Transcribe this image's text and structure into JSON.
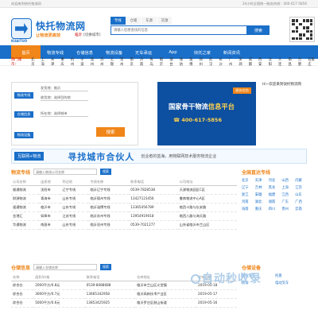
{
  "topbar": {
    "left": "欢迎来到快托物流网",
    "right": "24小时全国统一服务热线：400-617-5856"
  },
  "brand": {
    "name": "快托物流网",
    "slogan": "让物流更高效",
    "logo_text": "KUAITUO"
  },
  "city": {
    "name": "临沂",
    "switch": "[切换城市]"
  },
  "search": {
    "tabs": [
      "专线",
      "仓储",
      "车源",
      "货源"
    ],
    "placeholder": "请输入您想查找的信息",
    "button": "搜索"
  },
  "qr_label": "扫一扫关注快托物流网",
  "nav": [
    "首页",
    "物流专线",
    "仓储信息",
    "物流设备",
    "无车承运",
    "App",
    "快托之家",
    "新闻资讯"
  ],
  "citybar": {
    "label": "热门城市：",
    "cities": [
      "北京",
      "上海",
      "天津",
      "重庆",
      "杭州",
      "宁波",
      "温州",
      "苏州",
      "无锡",
      "常州",
      "南京",
      "济南",
      "青岛",
      "临沂",
      "烟台",
      "潍坊",
      "淄博",
      "郑州",
      "武汉",
      "长沙",
      "广州",
      "深圳",
      "成都",
      "西安",
      "沈阳",
      "大连",
      "南昌",
      "合肥",
      "石家庄"
    ]
  },
  "quick": {
    "line": {
      "label": "物流专线",
      "from_label": "发货地",
      "from_value": "临沂",
      "to_label": "收货地",
      "to_value": "选择目的地"
    },
    "warehouse": {
      "label": "仓储信息",
      "city_label": "所在地",
      "city_value": "选择城市"
    },
    "button": "搜索",
    "equip": {
      "label": "物流设备"
    }
  },
  "banner": {
    "badge": "服务优势",
    "headline_a": "国家骨干物流",
    "headline_b": "信息平台",
    "phone": "400-617-5856"
  },
  "side": {
    "title": "Hi~欢迎来到快托物流网"
  },
  "ad": {
    "tag": "互联网+物流",
    "main": "寻找城市合伙人",
    "sub": "创业者的蓝海，用物联网技术服务物流企业"
  },
  "lines": {
    "title": "物流专线",
    "search_placeholder": "请输入物流公司名称",
    "search_button": "搜索",
    "columns": [
      "公司名称",
      "出发地",
      "到达地",
      "专线名称",
      "联系电话",
      "公司地址"
    ],
    "rows": [
      [
        "顺通物流",
        "沈阳市",
        "辽宁专线",
        "临沂辽宁专线",
        "0539-7828538",
        "天源物流园区C区"
      ],
      [
        "财源物流",
        "青海市",
        "山东专线",
        "临沂德州专线",
        "13427123456",
        "鲁南物流中心A区"
      ],
      [
        "速通物流",
        "临沂市",
        "山东专线",
        "临沂淄博专线",
        "13365456789",
        "临西十路与长安路"
      ],
      [
        "金港汇",
        "如皋市",
        "江苏专线",
        "临沂苏州专线",
        "13954919018",
        "临西八路与海天路"
      ],
      [
        "华通物流",
        "南昌市",
        "山东专线",
        "临沂沧州专线",
        "0539-7021277",
        "山东省临沂市兰山区"
      ]
    ]
  },
  "lines_right": {
    "title": "全国直达专线",
    "provinces": [
      "北京",
      "天津",
      "河北",
      "山西",
      "内蒙",
      "辽宁",
      "吉林",
      "黑龙",
      "上海",
      "江苏",
      "浙江",
      "安徽",
      "福建",
      "江西",
      "山东",
      "河南",
      "湖北",
      "湖南",
      "广东",
      "广西",
      "海南",
      "重庆",
      "四川",
      "贵州",
      "云南"
    ]
  },
  "warehouse": {
    "title": "仓储信息",
    "search_placeholder": "请输入仓储名称",
    "search_button": "搜索",
    "columns": [
      "名称",
      "面积/价格",
      "联系电话",
      "仓库地址",
      "发布日期"
    ],
    "rows": [
      [
        "综合仓",
        "2000平方/0.8元",
        "0539-8088688",
        "临沂市兰山区义堂镇",
        "2019-05-18"
      ],
      [
        "综合仓",
        "3000平方/0.7元",
        "13665342958",
        "临沂高新技术产业区",
        "2019-05-17"
      ],
      [
        "综合仓",
        "5000平方/0.6元",
        "13853425925",
        "临沂罗庄区册山街道",
        "2019-05-16"
      ]
    ]
  },
  "warehouse_right": {
    "title": "仓储设备",
    "items": [
      "液压叉车",
      "托盘",
      "货架",
      "电动叉车"
    ]
  },
  "watermark": "自动秒收录"
}
